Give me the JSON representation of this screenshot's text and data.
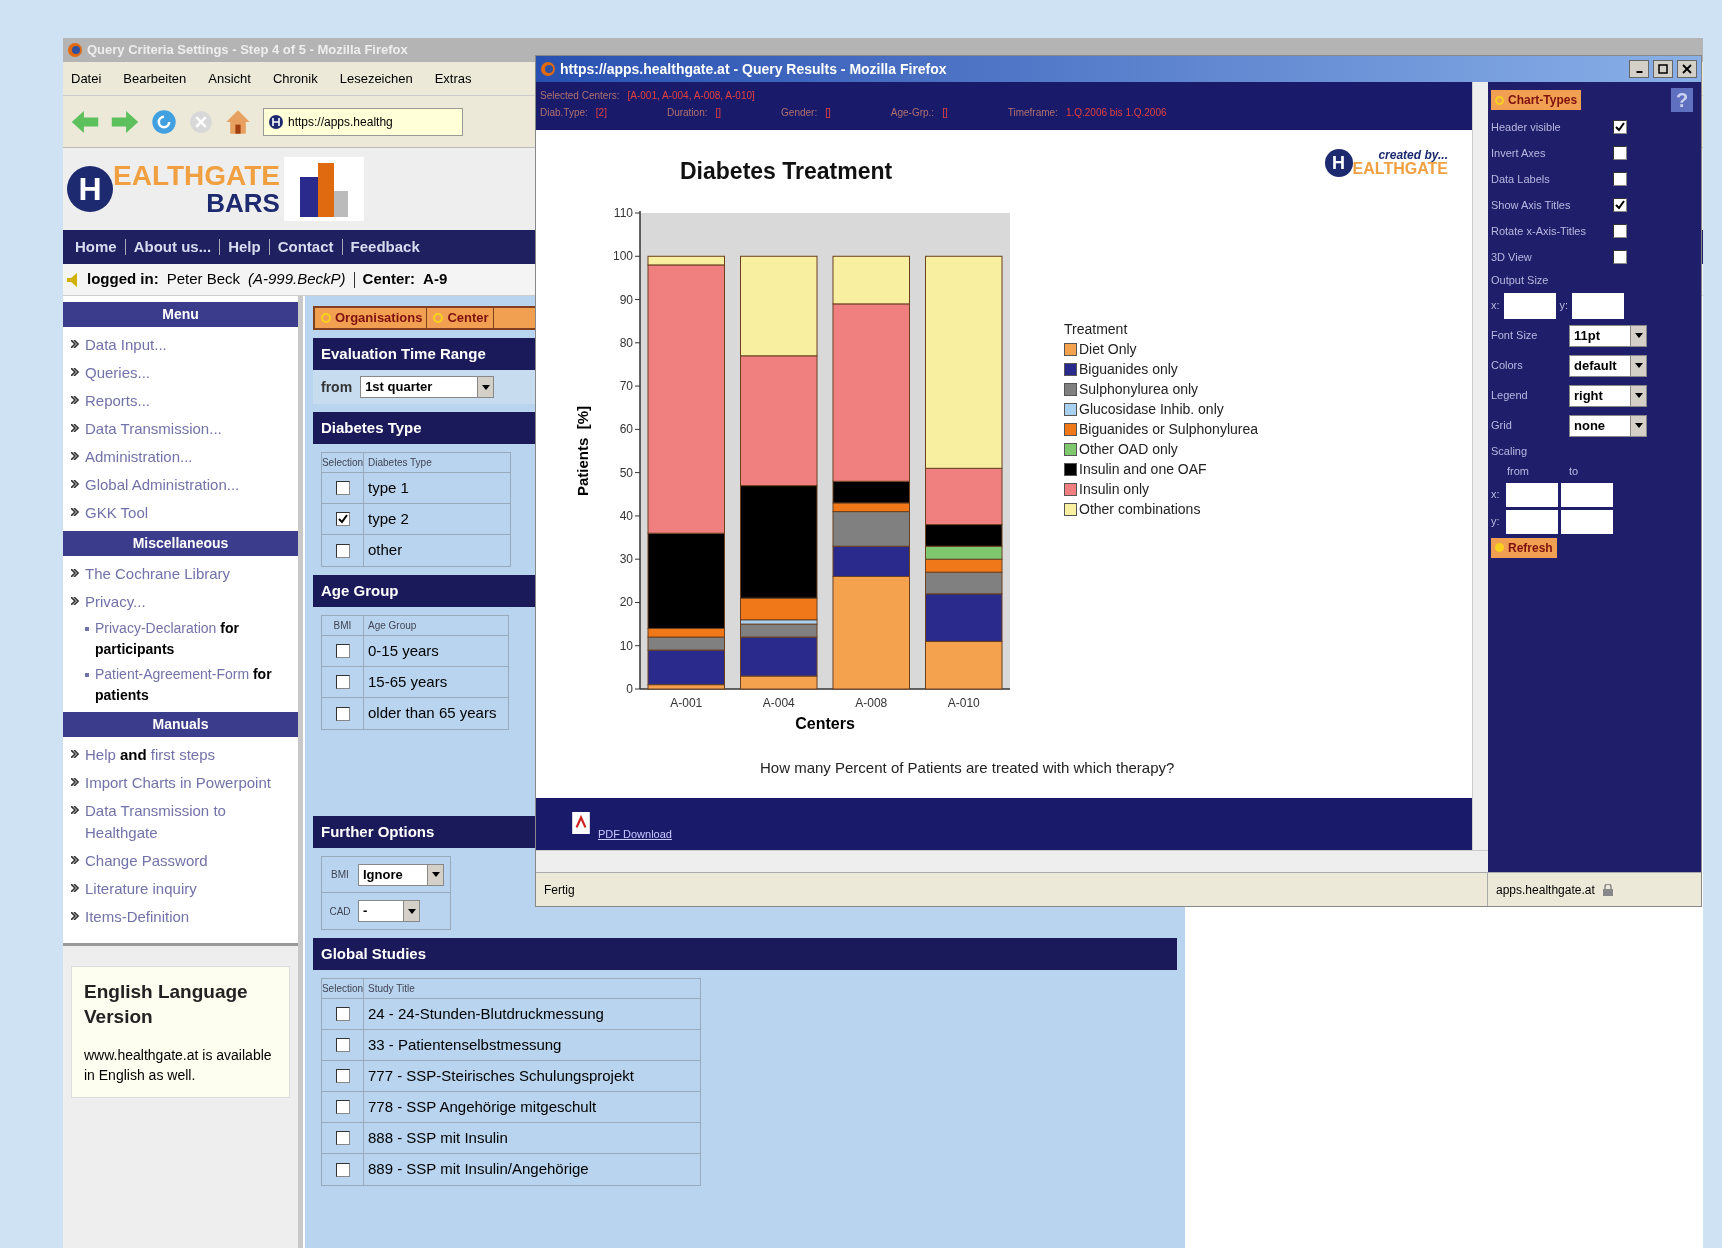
{
  "back_window": {
    "title": "Query Criteria Settings - Step 4 of 5 - Mozilla Firefox",
    "menu": [
      "Datei",
      "Bearbeiten",
      "Ansicht",
      "Chronik",
      "Lesezeichen",
      "Extras"
    ],
    "address": "https://apps.healthg",
    "logo": {
      "initial": "H",
      "text": "EALTHGATE",
      "subtitle": "BARS"
    },
    "nav": [
      "Home",
      "About us...",
      "Help",
      "Contact",
      "Feedback"
    ],
    "login": {
      "label": "logged in:",
      "name": "Peter Beck",
      "account": "(A-999.BeckP)",
      "center_label": "Center:",
      "center": "A-9"
    },
    "sidebar": [
      {
        "title": "Menu",
        "items": [
          {
            "kind": "item",
            "text": "Data Input..."
          },
          {
            "kind": "item",
            "text": "Queries..."
          },
          {
            "kind": "item",
            "text": "Reports..."
          },
          {
            "kind": "item",
            "text": "Data Transmission..."
          },
          {
            "kind": "item",
            "text": "Administration..."
          },
          {
            "kind": "item",
            "text": "Global Administration..."
          },
          {
            "kind": "item",
            "text": "GKK Tool"
          }
        ]
      },
      {
        "title": "Miscellaneous",
        "items": [
          {
            "kind": "item",
            "text": "The Cochrane Library"
          },
          {
            "kind": "item",
            "text": "Privacy..."
          },
          {
            "kind": "subitem",
            "text": "Privacy-Declaration **for participants**"
          },
          {
            "kind": "subitem",
            "text": "Patient-Agreement-Form **for patients**"
          }
        ]
      },
      {
        "title": "Manuals",
        "items": [
          {
            "kind": "item",
            "text": "Help **and** first steps"
          },
          {
            "kind": "item",
            "text": "Import Charts in Powerpoint"
          },
          {
            "kind": "item",
            "text": "Data Transmission to Healthgate"
          },
          {
            "kind": "item",
            "text": "Change Password"
          },
          {
            "kind": "item",
            "text": "Literature inquiry"
          },
          {
            "kind": "item",
            "text": "Items-Definition"
          }
        ]
      }
    ],
    "info_box": {
      "title": "English Language Version",
      "text": "www.healthgate.at is available in English as well."
    },
    "tabs": [
      "Organisations",
      "Center"
    ],
    "time_range": {
      "title": "Evaluation Time Range",
      "label": "from",
      "value": "1st quarter"
    },
    "diabetes_type": {
      "title": "Diabetes Type",
      "columns": [
        "Selection",
        "Diabetes Type"
      ],
      "rows": [
        {
          "label": "type 1",
          "checked": false
        },
        {
          "label": "type 2",
          "checked": true
        },
        {
          "label": "other",
          "checked": false
        }
      ]
    },
    "age_group": {
      "title": "Age Group",
      "columns": [
        "BMI",
        "Age Group"
      ],
      "rows": [
        {
          "label": "0-15 years",
          "checked": false
        },
        {
          "label": "15-65 years",
          "checked": false
        },
        {
          "label": "older than 65 years",
          "checked": false
        }
      ]
    },
    "further_options": {
      "title": "Further Options",
      "fields": [
        {
          "label": "BMI",
          "value": "Ignore"
        },
        {
          "label": "CAD",
          "value": "-"
        }
      ]
    },
    "global_studies": {
      "title": "Global Studies",
      "columns": [
        "Selection",
        "Study Title"
      ],
      "rows": [
        {
          "label": "24 - 24-Stunden-Blutdruckmessung",
          "checked": false
        },
        {
          "label": "33 - Patientenselbstmessung",
          "checked": false
        },
        {
          "label": "777 - SSP-Steirisches Schulungsprojekt",
          "checked": false
        },
        {
          "label": "778 - SSP Angehörige mitgeschult",
          "checked": false
        },
        {
          "label": "888 - SSP mit Insulin",
          "checked": false
        },
        {
          "label": "889 - SSP mit Insulin/Angehörige",
          "checked": false
        }
      ]
    }
  },
  "results_window": {
    "title": "https://apps.healthgate.at - Query Results - Mozilla Firefox",
    "filters": {
      "centers_label": "Selected Centers:",
      "centers": "[A-001, A-004, A-008, A-010]",
      "fields": [
        {
          "label": "Diab.Type:",
          "value": "[2]"
        },
        {
          "label": "Duration:",
          "value": "[]"
        },
        {
          "label": "Gender:",
          "value": "[]"
        },
        {
          "label": "Age-Grp.:",
          "value": "[]"
        },
        {
          "label": "Timeframe:",
          "value": "1.Q.2006 bis 1.Q.2006"
        }
      ]
    },
    "logo": {
      "caption": "created by...",
      "initial": "H",
      "text": "EALTHGATE"
    },
    "chart": {
      "legend_title": "Treatment",
      "chart_data": {
        "type": "bar",
        "title": "Diabetes Treatment",
        "xlabel": "Centers",
        "ylabel": "Patients  [%]",
        "stacked": true,
        "categories": [
          "A-001",
          "A-004",
          "A-008",
          "A-010"
        ],
        "ylim": [
          0,
          110
        ],
        "yticks": [
          0,
          10,
          20,
          30,
          40,
          50,
          60,
          70,
          80,
          90,
          100,
          110
        ],
        "series": [
          {
            "name": "Diet Only",
            "color": "#f4a24e",
            "values": [
              1,
              3,
              26,
              11
            ]
          },
          {
            "name": "Biguanides only",
            "color": "#2a2a8c",
            "values": [
              8,
              9,
              7,
              11
            ]
          },
          {
            "name": "Sulphonylurea only",
            "color": "#808080",
            "values": [
              3,
              3,
              8,
              5
            ]
          },
          {
            "name": "Glucosidase Inhib. only",
            "color": "#a8d0f0",
            "values": [
              0,
              1,
              0,
              0
            ]
          },
          {
            "name": "Biguanides or Sulphonylurea",
            "color": "#f07818",
            "values": [
              2,
              5,
              2,
              3
            ]
          },
          {
            "name": "Other OAD only",
            "color": "#80c870",
            "values": [
              0,
              0,
              0,
              3
            ]
          },
          {
            "name": "Insulin and one OAF",
            "color": "#000000",
            "values": [
              22,
              26,
              5,
              5
            ]
          },
          {
            "name": "Insulin only",
            "color": "#f08080",
            "values": [
              62,
              30,
              41,
              13
            ]
          },
          {
            "name": "Other combinations",
            "color": "#f8f0a0",
            "values": [
              2,
              23,
              11,
              49
            ]
          }
        ]
      }
    },
    "question": "How many Percent of Patients are treated with which therapy?",
    "pdf_link": "PDF Download",
    "settings": {
      "button": "Chart-Types",
      "help": "?",
      "options": [
        {
          "kind": "checkbox",
          "label": "Header visible",
          "checked": true
        },
        {
          "kind": "checkbox",
          "label": "Invert Axes",
          "checked": false
        },
        {
          "kind": "checkbox",
          "label": "Data Labels",
          "checked": false
        },
        {
          "kind": "checkbox",
          "label": "Show Axis Titles",
          "checked": true
        },
        {
          "kind": "checkbox",
          "label": "Rotate x-Axis-Titles",
          "checked": false
        },
        {
          "kind": "checkbox",
          "label": "3D View",
          "checked": false
        },
        {
          "kind": "heading",
          "label": "Output Size"
        },
        {
          "kind": "size",
          "x_label": "x:",
          "y_label": "y:"
        },
        {
          "kind": "select",
          "label": "Font Size",
          "value": "11pt"
        },
        {
          "kind": "select",
          "label": "Colors",
          "value": "default"
        },
        {
          "kind": "select",
          "label": "Legend",
          "value": "right"
        },
        {
          "kind": "select",
          "label": "Grid",
          "value": "none"
        },
        {
          "kind": "heading",
          "label": "Scaling"
        },
        {
          "kind": "scaling",
          "from_label": "from",
          "to_label": "to",
          "rows": [
            "x:",
            "y:"
          ]
        }
      ],
      "refresh": "Refresh"
    },
    "status": "Fertig",
    "host": "apps.healthgate.at"
  }
}
